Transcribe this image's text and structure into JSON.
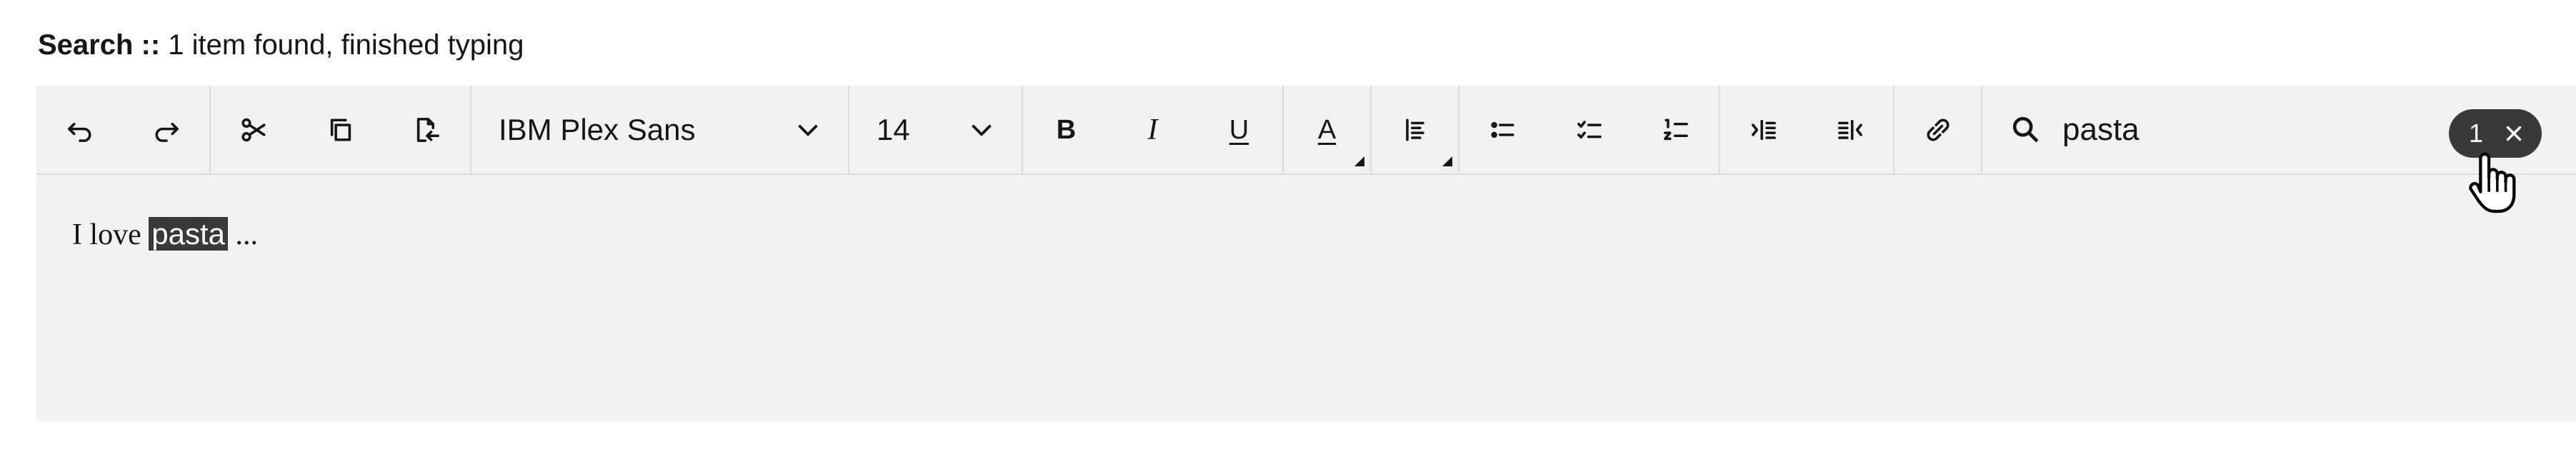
{
  "status": {
    "label": "Search ::",
    "message": " 1 item found, finished typing"
  },
  "toolbar": {
    "font_family": "IBM Plex Sans",
    "font_size": "14",
    "bold": "B",
    "italic": "I",
    "underline": "U",
    "text_color": "A"
  },
  "search": {
    "query": "pasta",
    "count": "1"
  },
  "content": {
    "before": "I love ",
    "match": "pasta",
    "after": " ..."
  }
}
